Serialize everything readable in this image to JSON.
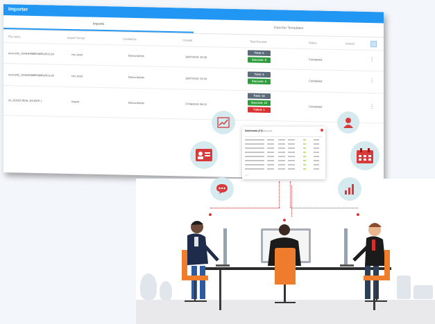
{
  "importer": {
    "title": "Importer",
    "tabs": [
      {
        "label": "Imports"
      },
      {
        "label": "Importer Templates"
      }
    ],
    "columns": [
      "File name",
      "Import Format",
      "Created by",
      "Created",
      "Total Records",
      "Status",
      "Actions"
    ],
    "rows": [
      {
        "file_name": "accounts_2b4e4b5b8f63b5fa2fc1c19",
        "format": "csv_load",
        "created_by": "Dema Admin",
        "created": "19/07/2021 15:26",
        "badges": [
          {
            "label": "Total: 5",
            "kind": "total"
          },
          {
            "label": "Success: 5",
            "kind": "success"
          }
        ],
        "status": "Completed"
      },
      {
        "file_name": "accounts_2b4e4b5b8f63b5fa2fc1c19",
        "format": "csv_load",
        "created_by": "Dema Admin",
        "created": "19/07/2021 15:16",
        "badges": [
          {
            "label": "Total: 3",
            "kind": "total"
          },
          {
            "label": "Success: 3",
            "kind": "success"
          }
        ],
        "status": "Completed"
      },
      {
        "file_name": "AL GOOD REAL ESTATE L",
        "format": "Import",
        "created_by": "Dema Admin",
        "created": "27/06/2021 08:13",
        "badges": [
          {
            "label": "Total: 15",
            "kind": "total"
          },
          {
            "label": "Success: 12",
            "kind": "success"
          },
          {
            "label": "Failed: 1",
            "kind": "failed"
          }
        ],
        "status": "Completed"
      }
    ]
  },
  "illustration": {
    "mini_dashboard": {
      "title": "Dashboard (27)",
      "filter": "All Records"
    },
    "bubble_icons": [
      "trend-chart-icon",
      "user-icon",
      "id-card-icon",
      "calendar-icon",
      "chat-bubble-icon",
      "bar-chart-icon"
    ],
    "accent_color": "#d63a3a",
    "bubble_color": "#d5eaee"
  }
}
